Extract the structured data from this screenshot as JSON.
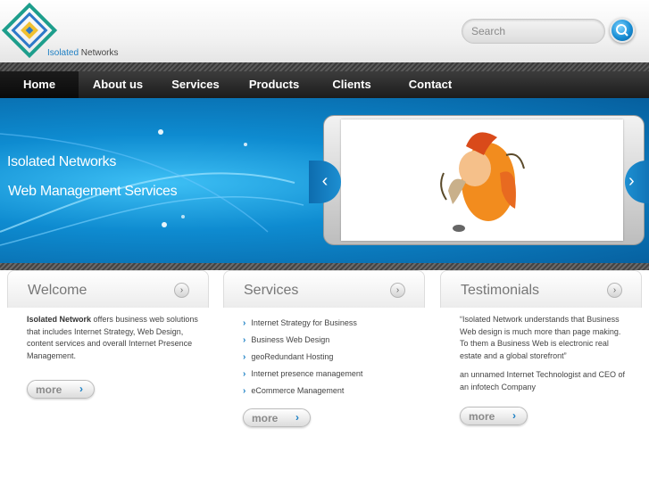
{
  "brand": {
    "part1": "Isolated",
    "part2": " Networks"
  },
  "search": {
    "label": "Search",
    "value": ""
  },
  "nav": {
    "items": [
      "Home",
      "About us",
      "Services",
      "Products",
      "Clients",
      "Contact"
    ],
    "active": "Home"
  },
  "banner": {
    "line1": "Isolated Networks",
    "line2": "Web Management Services"
  },
  "welcome": {
    "title": "Welcome",
    "bold": "Isolated Network",
    "text": " offers business web solutions that includes Internet Strategy, Web Design, content services and overall Internet Presence Management.",
    "more": "more"
  },
  "services": {
    "title": "Services",
    "items": [
      "Internet Strategy for Business",
      "Business Web Design",
      "geoRedundant Hosting",
      "Internet presence management",
      "eCommerce Management"
    ],
    "more": "more"
  },
  "testimonials": {
    "title": "Testimonials",
    "quote": "“Isolated Network understands that Business Web design is much more than page making. To them a Business Web is electronic real estate and a global storefront”",
    "author": "an unnamed Internet Technologist and CEO of an infotech Company",
    "more": "more"
  },
  "colors": {
    "accent": "#1a7fc4",
    "nav_bg": "#2a2a2a",
    "banner": "#0e8bd0"
  }
}
